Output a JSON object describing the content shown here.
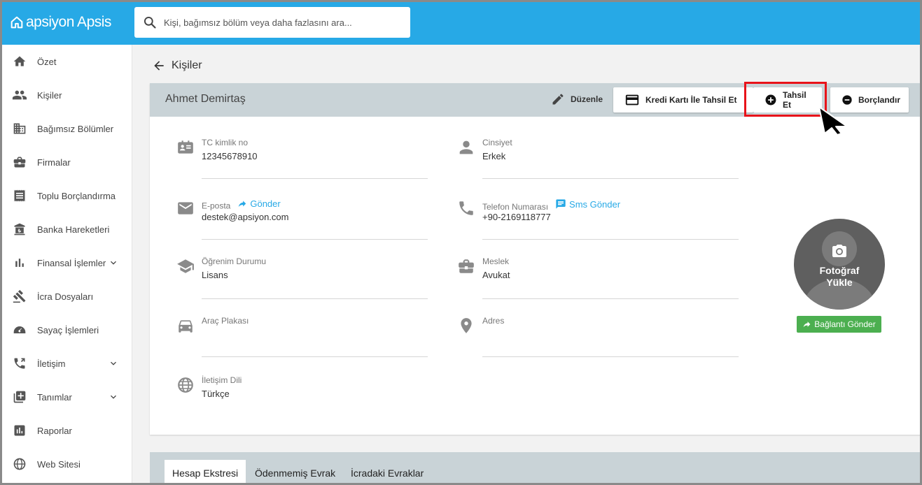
{
  "app": {
    "logo_text": "apsiyon Apsis"
  },
  "search": {
    "placeholder": "Kişi, bağımsız bölüm veya daha fazlasını ara..."
  },
  "sidebar": {
    "items": [
      {
        "label": "Özet",
        "icon": "home-icon"
      },
      {
        "label": "Kişiler",
        "icon": "people-icon"
      },
      {
        "label": "Bağımsız Bölümler",
        "icon": "building-icon"
      },
      {
        "label": "Firmalar",
        "icon": "briefcase-icon"
      },
      {
        "label": "Toplu Borçlandırma",
        "icon": "receipt-icon"
      },
      {
        "label": "Banka Hareketleri",
        "icon": "bank-icon"
      },
      {
        "label": "Finansal İşlemler",
        "icon": "bar-chart-icon"
      },
      {
        "label": "İcra Dosyaları",
        "icon": "gavel-icon"
      },
      {
        "label": "Sayaç İşlemleri",
        "icon": "meter-icon"
      },
      {
        "label": "İletişim",
        "icon": "phone-icon"
      },
      {
        "label": "Tanımlar",
        "icon": "add-box-icon"
      },
      {
        "label": "Raporlar",
        "icon": "report-icon"
      },
      {
        "label": "Web Sitesi",
        "icon": "globe-icon"
      }
    ]
  },
  "main": {
    "back_label": "Kişiler",
    "person_name": "Ahmet Demirtaş",
    "actions": {
      "edit": "Düzenle",
      "credit_card": "Kredi Kartı İle Tahsil Et",
      "collect": "Tahsil Et",
      "debit": "Borçlandır"
    },
    "fields": {
      "tc": {
        "label": "TC kimlik no",
        "value": "12345678910"
      },
      "gender": {
        "label": "Cinsiyet",
        "value": "Erkek"
      },
      "email": {
        "label": "E-posta",
        "value": "destek@apsiyon.com",
        "link": "Gönder"
      },
      "phone": {
        "label": "Telefon Numarası",
        "value": "+90-2169118777",
        "link": "Sms Gönder"
      },
      "education": {
        "label": "Öğrenim Durumu",
        "value": "Lisans"
      },
      "job": {
        "label": "Meslek",
        "value": "Avukat"
      },
      "plate": {
        "label": "Araç Plakası",
        "value": ""
      },
      "address": {
        "label": "Adres",
        "value": ""
      },
      "language": {
        "label": "İletişim Dili",
        "value": "Türkçe"
      }
    },
    "photo": {
      "line1": "Fotoğraf",
      "line2": "Yükle",
      "send_link": "Bağlantı Gönder"
    },
    "tabs": [
      "Hesap Ekstresi",
      "Ödenmemiş Evrak",
      "İcradaki Evraklar"
    ]
  },
  "colors": {
    "topbar": "#27a9e6",
    "highlight": "#e8131a",
    "link": "#27a9e6",
    "green": "#4caf50"
  }
}
